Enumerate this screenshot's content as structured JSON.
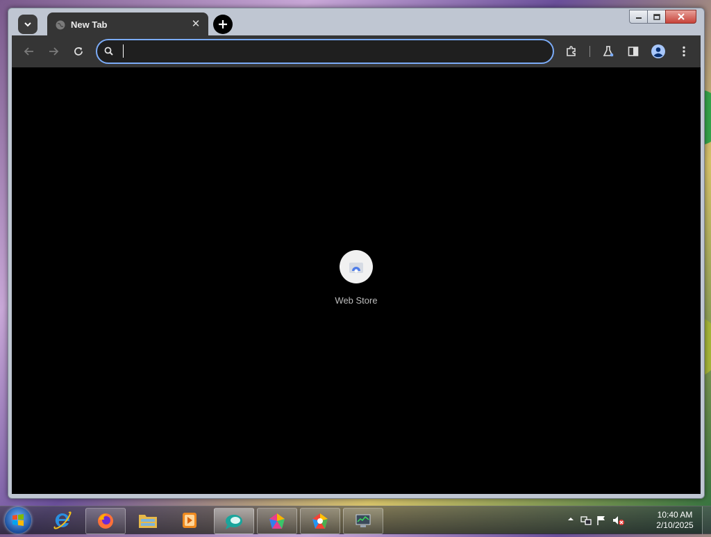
{
  "browser": {
    "tab": {
      "title": "New Tab",
      "close_glyph": "✕"
    },
    "new_tab_glyph": "+",
    "window_controls": {
      "minimize": "minimize-icon",
      "maximize": "maximize-icon",
      "close": "close-icon"
    },
    "toolbar": {
      "back": "back-arrow-icon",
      "forward": "forward-arrow-icon",
      "reload": "reload-icon",
      "omnibox": {
        "value": "",
        "placeholder": ""
      },
      "extensions": "puzzle-icon",
      "labs": "flask-icon",
      "side_panel": "side-panel-icon",
      "profile": "avatar-icon",
      "menu": "kebab-menu-icon"
    },
    "accent_color": "#7cacf8",
    "shortcut": {
      "label": "Web Store"
    }
  },
  "taskbar": {
    "items": [
      "internet-explorer-icon",
      "firefox-icon",
      "file-explorer-icon",
      "media-player-icon",
      "app-icon-teal",
      "app-icon-colorful-1",
      "app-icon-colorful-2",
      "task-manager-icon"
    ],
    "clock": {
      "time": "10:40 AM",
      "date": "2/10/2025"
    }
  }
}
